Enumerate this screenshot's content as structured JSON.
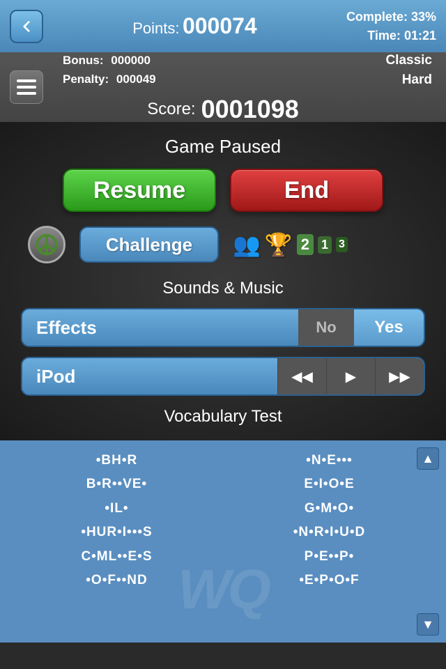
{
  "topbar": {
    "points_label": "Points:",
    "points_value": "000074",
    "complete_label": "Complete:",
    "complete_value": "33%",
    "time_label": "Time:",
    "time_value": "01:21",
    "back_label": "◀"
  },
  "statsbar": {
    "bonus_label": "Bonus:",
    "bonus_value": "000000",
    "penalty_label": "Penalty:",
    "penalty_value": "000049",
    "mode1": "Classic",
    "mode2": "Hard",
    "score_label": "Score:",
    "score_value": "0001098"
  },
  "game": {
    "paused_label": "Game Paused",
    "resume_label": "Resume",
    "end_label": "End",
    "challenge_label": "Challenge"
  },
  "sounds": {
    "section_label": "Sounds & Music",
    "effects_label": "Effects",
    "toggle_no": "No",
    "toggle_yes": "Yes",
    "ipod_label": "iPod",
    "rewind_label": "◀◀",
    "play_label": "▶",
    "fast_forward_label": "▶▶"
  },
  "vocab": {
    "section_label": "Vocabulary Test",
    "left_words": [
      "•BH•R",
      "B•R••VE•",
      "•IL•",
      "•HUR•I•••S",
      "C•ML••E•S",
      "•O•F••ND"
    ],
    "right_words": [
      "•N•E•••",
      "E•I•O•E",
      "G•M•O•",
      "•N•R•I•U•D",
      "P•E••P•",
      "•E•P•O•F"
    ]
  }
}
